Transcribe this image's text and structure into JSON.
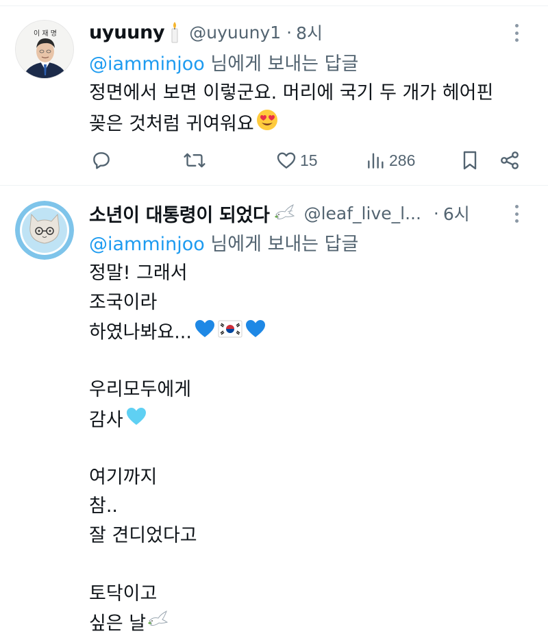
{
  "tweets": [
    {
      "display_name": "uyuuny",
      "name_emoji": "candle-icon",
      "handle": "@uyuuny1",
      "separator": "·",
      "time": "8시",
      "reply_mention": "@iamminjoo",
      "reply_suffix": " 님에게 보내는 답글",
      "avatar_sign_text": "이 재 명",
      "lines": [
        "정면에서 보면 이렇군요. 머리에 국기 두 개가 헤어핀",
        "꽂은 것처럼 귀여워요"
      ],
      "actions": {
        "likes": "15",
        "views": "286"
      }
    },
    {
      "display_name": "소년이 대통령이 되었다",
      "name_emoji": "dove-icon",
      "handle": "@leaf_live_l...",
      "separator": "·",
      "time": "6시",
      "reply_mention": "@iamminjoo",
      "reply_suffix": " 님에게 보내는 답글",
      "lines": [
        "정말! 그래서",
        "조국이라",
        "하였나봐요...",
        "",
        "우리모두에게",
        "감사",
        "",
        "여기까지",
        "참..",
        "잘 견디었다고",
        "",
        "토닥이고",
        "싶은 날"
      ]
    }
  ],
  "colors": {
    "link": "#1d9bf0",
    "secondary_text": "#536471",
    "primary_text": "#0f1419",
    "divider": "#eff3f4"
  }
}
